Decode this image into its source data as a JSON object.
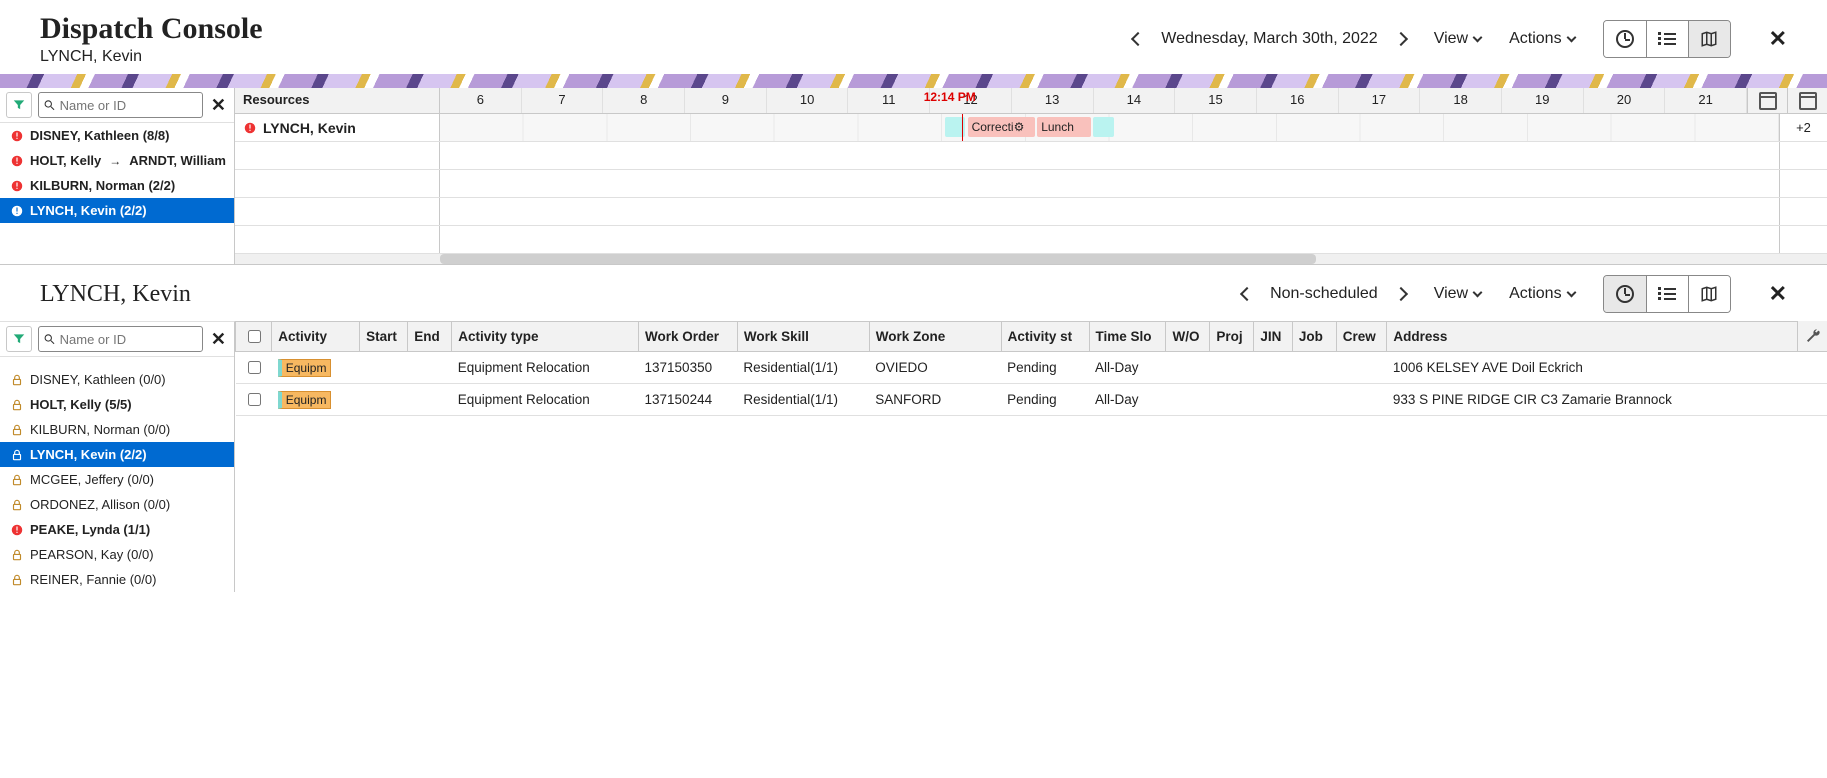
{
  "header": {
    "title": "Dispatch Console",
    "subtitle": "LYNCH, Kevin",
    "date": "Wednesday, March 30th, 2022",
    "view_label": "View",
    "actions_label": "Actions"
  },
  "gantt": {
    "resources_header": "Resources",
    "search_placeholder": "Name or ID",
    "hours": [
      "6",
      "7",
      "8",
      "9",
      "10",
      "11",
      "12",
      "13",
      "14",
      "15",
      "16",
      "17",
      "18",
      "19",
      "20",
      "21"
    ],
    "now_label": "12:14 PM",
    "now_position_pct": 39.0,
    "overflow_label": "+2",
    "row_resource": "LYNCH, Kevin",
    "blocks": [
      {
        "label": "",
        "left_pct": 37.7,
        "width_pct": 1.5,
        "bg": "#baf3f0"
      },
      {
        "label": "Correcti",
        "left_pct": 39.4,
        "width_pct": 5.0,
        "bg": "#f9c1bc",
        "icon": true
      },
      {
        "label": "Lunch",
        "left_pct": 44.6,
        "width_pct": 4.0,
        "bg": "#f9c1bc"
      },
      {
        "label": "",
        "left_pct": 48.8,
        "width_pct": 1.5,
        "bg": "#baf3f0"
      }
    ],
    "side_resources": [
      {
        "label": "DISNEY, Kathleen (8/8)",
        "icon": "alert",
        "bold": true
      },
      {
        "label": "HOLT, Kelly",
        "arrow_to": "ARNDT, William",
        "icon": "alert",
        "bold": true
      },
      {
        "label": "KILBURN, Norman (2/2)",
        "icon": "alert",
        "bold": true
      },
      {
        "label": "LYNCH, Kevin (2/2)",
        "icon": "alert",
        "bold": true,
        "selected": true
      }
    ]
  },
  "panel2": {
    "title": "LYNCH, Kevin",
    "filter_label": "Non-scheduled",
    "view_label": "View",
    "actions_label": "Actions",
    "search_placeholder": "Name or ID",
    "side_resources": [
      {
        "label": "DISNEY, Kathleen (0/0)",
        "icon": "lock"
      },
      {
        "label": "HOLT, Kelly (5/5)",
        "icon": "lock",
        "bold": true
      },
      {
        "label": "KILBURN, Norman (0/0)",
        "icon": "lock"
      },
      {
        "label": "LYNCH, Kevin (2/2)",
        "icon": "lock",
        "bold": true,
        "selected": true
      },
      {
        "label": "MCGEE, Jeffery (0/0)",
        "icon": "lock"
      },
      {
        "label": "ORDONEZ, Allison (0/0)",
        "icon": "lock"
      },
      {
        "label": "PEAKE, Lynda (1/1)",
        "icon": "alert",
        "bold": true
      },
      {
        "label": "PEARSON, Kay (0/0)",
        "icon": "lock"
      },
      {
        "label": "REINER, Fannie (0/0)",
        "icon": "lock"
      }
    ],
    "columns": [
      "",
      "Activity",
      "Start",
      "End",
      "Activity type",
      "Work Order",
      "Work Skill",
      "Work Zone",
      "Activity st",
      "Time Slo",
      "W/O",
      "Proj",
      "JIN",
      "Job",
      "Crew",
      "Address"
    ],
    "rows": [
      {
        "activity_chip": "Equipm",
        "activity_type": "Equipment Relocation",
        "work_order": "137150350",
        "work_skill": "Residential(1/1)",
        "work_zone": "OVIEDO",
        "status": "Pending",
        "slot": "All-Day",
        "address": "1006 KELSEY AVE Doil Eckrich"
      },
      {
        "activity_chip": "Equipm",
        "activity_type": "Equipment Relocation",
        "work_order": "137150244",
        "work_skill": "Residential(1/1)",
        "work_zone": "SANFORD",
        "status": "Pending",
        "slot": "All-Day",
        "address": "933 S PINE RIDGE CIR C3 Zamarie Brannock"
      }
    ]
  }
}
